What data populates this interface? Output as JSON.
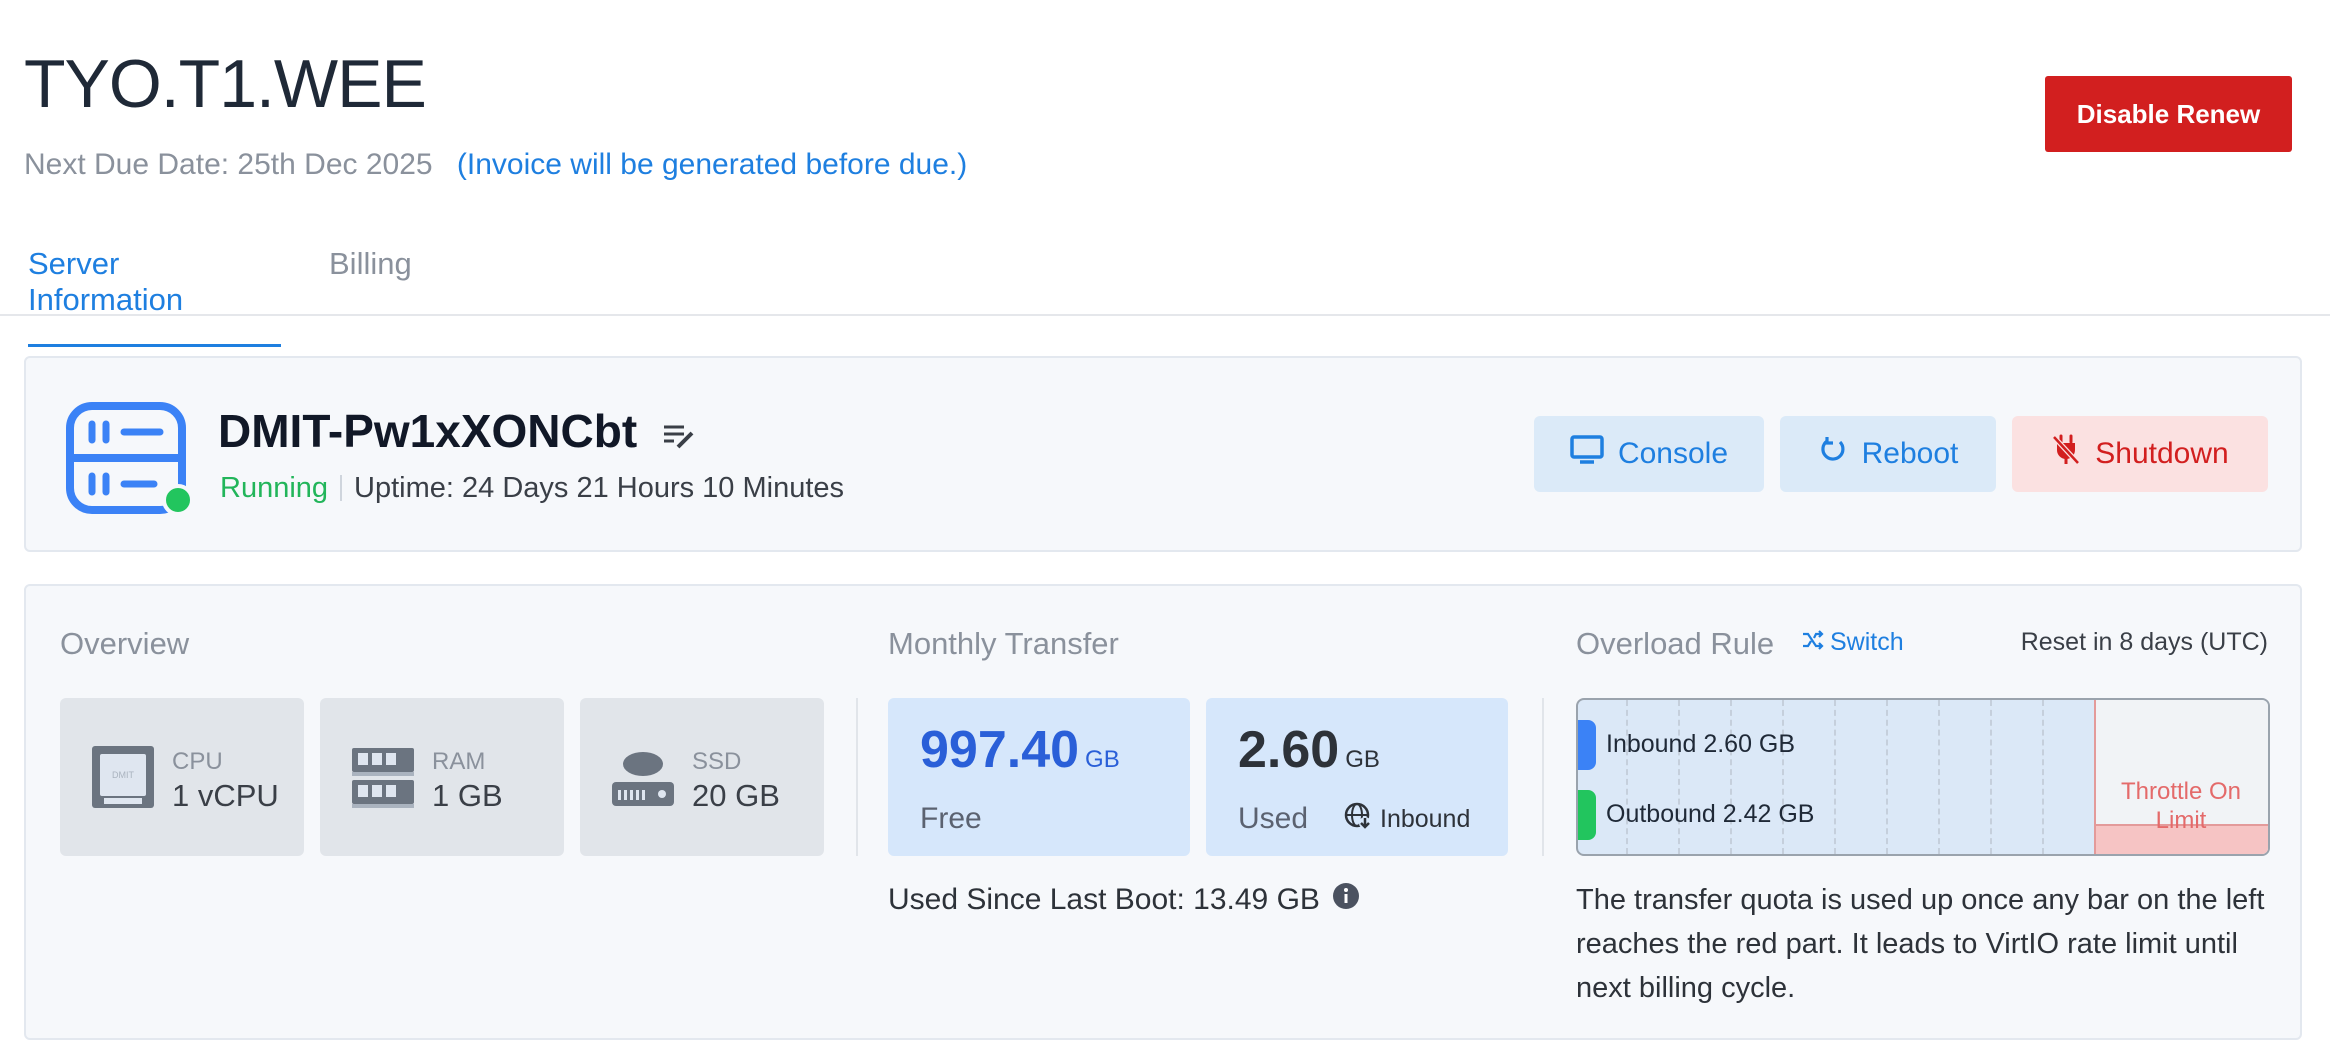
{
  "header": {
    "title": "TYO.T1.WEE",
    "due_label": "Next Due Date: 25th Dec 2025",
    "invoice_note": "(Invoice will be generated before due.)",
    "disable_renew": "Disable Renew"
  },
  "tabs": [
    {
      "label": "Server Information",
      "active": true
    },
    {
      "label": "Billing",
      "active": false
    }
  ],
  "server": {
    "name": "DMIT-Pw1xXONCbt",
    "status": "Running",
    "uptime": "Uptime: 24 Days 21 Hours 10 Minutes",
    "actions": {
      "console": "Console",
      "reboot": "Reboot",
      "shutdown": "Shutdown"
    }
  },
  "overview": {
    "label": "Overview",
    "cpu": {
      "label": "CPU",
      "value": "1 vCPU",
      "chip_text": "DMIT"
    },
    "ram": {
      "label": "RAM",
      "value": "1 GB"
    },
    "ssd": {
      "label": "SSD",
      "value": "20 GB"
    }
  },
  "transfer": {
    "label": "Monthly Transfer",
    "free": {
      "value": "997.40",
      "unit": "GB",
      "label": "Free"
    },
    "used": {
      "value": "2.60",
      "unit": "GB",
      "label": "Used",
      "direction": "Inbound"
    },
    "since_boot": "Used Since Last Boot: 13.49 GB"
  },
  "overload": {
    "label": "Overload Rule",
    "switch": "Switch",
    "reset": "Reset in 8 days (UTC)",
    "inbound": "Inbound 2.60 GB",
    "outbound": "Outbound 2.42 GB",
    "throttle": "Throttle On Limit",
    "note": "The transfer quota is used up once any bar on the left reaches the red part. It leads to VirtIO rate limit until next billing cycle."
  },
  "colors": {
    "accent": "#1e7fe0",
    "danger": "#d21f1f",
    "success": "#22b55a",
    "inbound_bar": "#3b82f6",
    "outbound_bar": "#22c55e"
  },
  "icons": {
    "server": "server-icon",
    "edit": "edit-note-icon",
    "console": "monitor-icon",
    "reboot": "refresh-icon",
    "shutdown": "power-off-icon",
    "cpu": "cpu-icon",
    "ram": "ram-icon",
    "ssd": "hard-drive-icon",
    "inbound": "globe-arrow-icon",
    "switch": "shuffle-icon",
    "info": "info-icon"
  }
}
